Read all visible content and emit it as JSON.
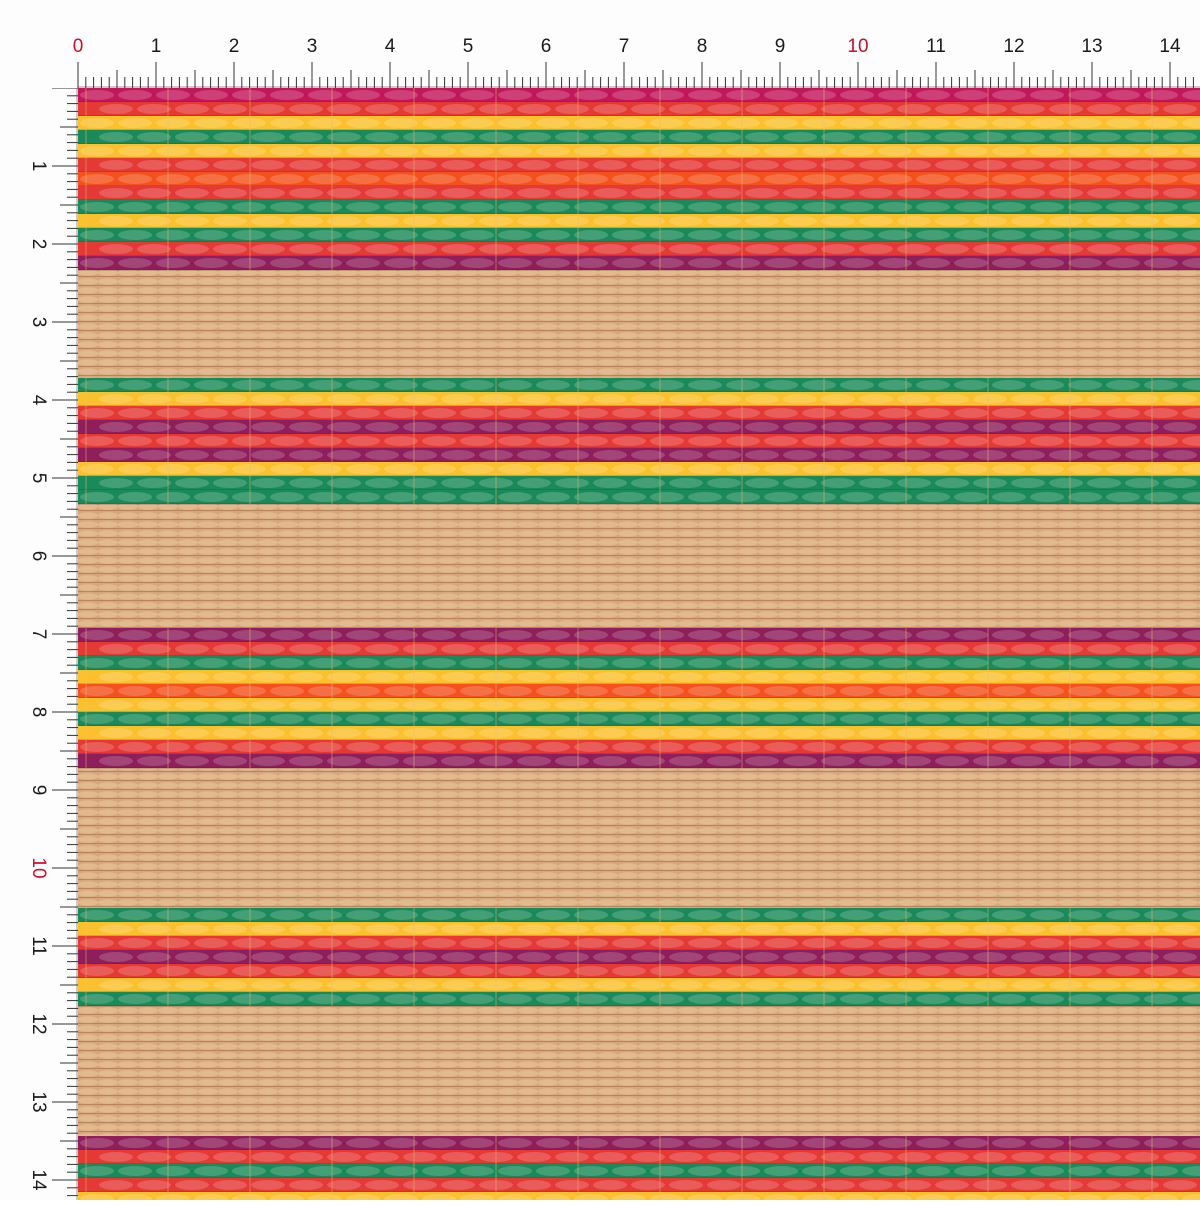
{
  "ruler": {
    "unit_labels": [
      "0",
      "1",
      "2",
      "3",
      "4",
      "5",
      "6",
      "7",
      "8",
      "9",
      "10",
      "11",
      "12",
      "13",
      "14"
    ],
    "major_color": "#1a1a1a",
    "accent_color": "#c8102e",
    "accent_labels": [
      "0",
      "10"
    ]
  },
  "photo": {
    "subject": "woven-straw-mat",
    "band_rows": [
      [
        "#c2185b",
        "#e53935",
        "#fbc02d",
        "#1b8a5a",
        "#fbc02d",
        "#e53935",
        "#f4511e",
        "#e53935",
        "#1b8a5a",
        "#fbc02d",
        "#1b8a5a",
        "#e53935",
        "#8e1e5c"
      ],
      [
        "#1b8a5a",
        "#fbc02d",
        "#e53935",
        "#8e1e5c",
        "#e53935",
        "#8e1e5c",
        "#fbc02d",
        "#1b8a5a",
        "#1b8a5a"
      ],
      [
        "#8e1e5c",
        "#e53935",
        "#1b8a5a",
        "#fbc02d",
        "#f4511e",
        "#fbc02d",
        "#1b8a5a",
        "#fbc02d",
        "#e53935",
        "#8e1e5c"
      ],
      [
        "#1b8a5a",
        "#fbc02d",
        "#e53935",
        "#8e1e5c",
        "#e53935",
        "#fbc02d",
        "#1b8a5a"
      ],
      [
        "#8e1e5c",
        "#e53935",
        "#1b8a5a",
        "#e53935",
        "#fbc02d"
      ]
    ],
    "straw_color": "#d9aa7e"
  }
}
